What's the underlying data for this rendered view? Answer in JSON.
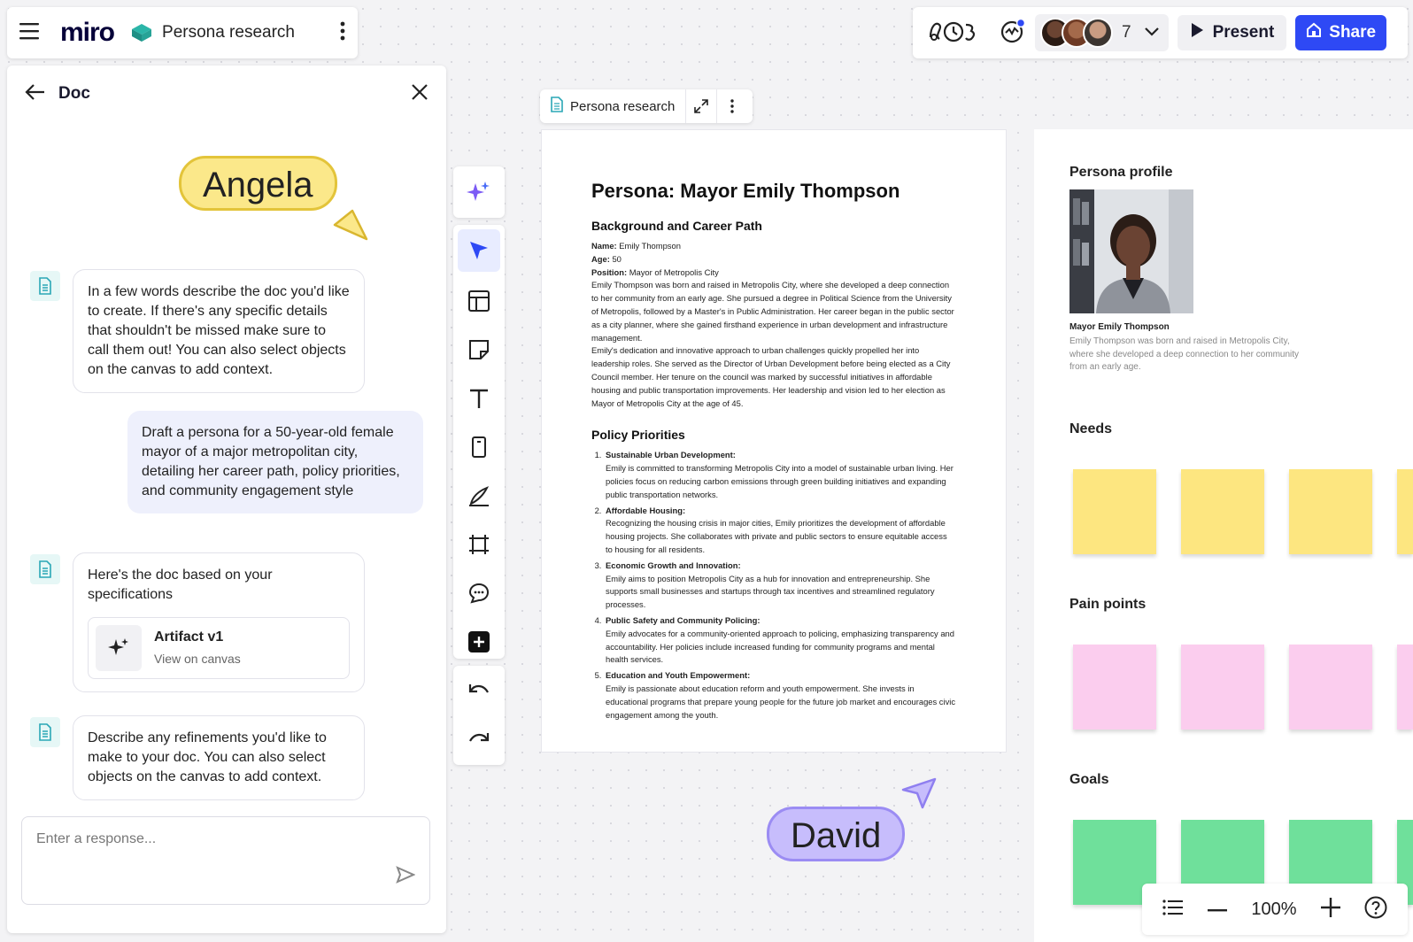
{
  "app": {
    "logo": "miro",
    "board_name": "Persona research"
  },
  "topbar": {
    "collaborator_count": "7",
    "present_label": "Present",
    "share_label": "Share"
  },
  "doc_panel": {
    "title": "Doc",
    "messages": [
      {
        "role": "ai",
        "text": "In a few words describe the doc you'd like to create. If there's any specific details that shouldn't be missed make sure to call them out! You can also select objects on the canvas to add context."
      },
      {
        "role": "user",
        "text": "Draft a persona for a 50-year-old female mayor of a major metropolitan city, detailing her career path, policy priorities, and community engagement style"
      },
      {
        "role": "ai",
        "text": "Here's the doc based on your specifications",
        "artifact_title": "Artifact v1",
        "artifact_subtitle": "View on canvas"
      },
      {
        "role": "ai",
        "text": "Describe any refinements you'd like to make to your doc. You can also select objects on the canvas to add context."
      }
    ],
    "input_placeholder": "Enter a response..."
  },
  "cursors": {
    "angela": "Angela",
    "david": "David"
  },
  "doc_pill": {
    "name": "Persona research"
  },
  "document": {
    "title": "Persona: Mayor Emily Thompson",
    "bg_heading": "Background and Career Path",
    "name_label": "Name:",
    "name_value": "Emily Thompson",
    "age_label": "Age:",
    "age_value": "50",
    "position_label": "Position:",
    "position_value": "Mayor of Metropolis City",
    "bg_p1": "Emily Thompson was born and raised in Metropolis City, where she developed a deep connection to her community from an early age. She pursued a degree in Political Science from the University of Metropolis, followed by a Master's in Public Administration. Her career began in the public sector as a city planner, where she gained firsthand experience in urban development and infrastructure management.",
    "bg_p2": "Emily's dedication and innovative approach to urban challenges quickly propelled her into leadership roles. She served as the Director of Urban Development before being elected as a City Council member. Her tenure on the council was marked by successful initiatives in affordable housing and public transportation improvements. Her leadership and vision led to her election as Mayor of Metropolis City at the age of 45.",
    "policy_heading": "Policy Priorities",
    "policies": [
      {
        "title": "Sustainable Urban Development:",
        "text": "Emily is committed to transforming Metropolis City into a model of sustainable urban living. Her policies focus on reducing carbon emissions through green building initiatives and expanding public transportation networks."
      },
      {
        "title": "Affordable Housing:",
        "text": "Recognizing the housing crisis in major cities, Emily prioritizes the development of affordable housing projects. She collaborates with private and public sectors to ensure equitable access to housing for all residents."
      },
      {
        "title": "Economic Growth and Innovation:",
        "text": "Emily aims to position Metropolis City as a hub for innovation and entrepreneurship. She supports small businesses and startups through tax incentives and streamlined regulatory processes."
      },
      {
        "title": "Public Safety and Community Policing:",
        "text": "Emily advocates for a community-oriented approach to policing, emphasizing transparency and accountability. Her policies include increased funding for community programs and mental health services."
      },
      {
        "title": "Education and Youth Empowerment:",
        "text": "Emily is passionate about education reform and youth empowerment. She invests in educational programs that prepare young people for the future job market and encourages civic engagement among the youth."
      }
    ]
  },
  "board": {
    "profile_title": "Persona profile",
    "profile_caption_title": "Mayor Emily Thompson",
    "profile_caption_text": "Emily Thompson was born and raised in Metropolis City, where she developed a deep connection to her community from an early age.",
    "needs_title": "Needs",
    "pain_title": "Pain points",
    "goals_title": "Goals",
    "colors": {
      "needs": "#fde680",
      "pain": "#fbcdee",
      "goals": "#6fe09b"
    }
  },
  "zoom": {
    "level": "100%"
  },
  "colors": {
    "accent": "#2e49f5",
    "angela": "#fbe88a",
    "david": "#c7bdfc"
  }
}
